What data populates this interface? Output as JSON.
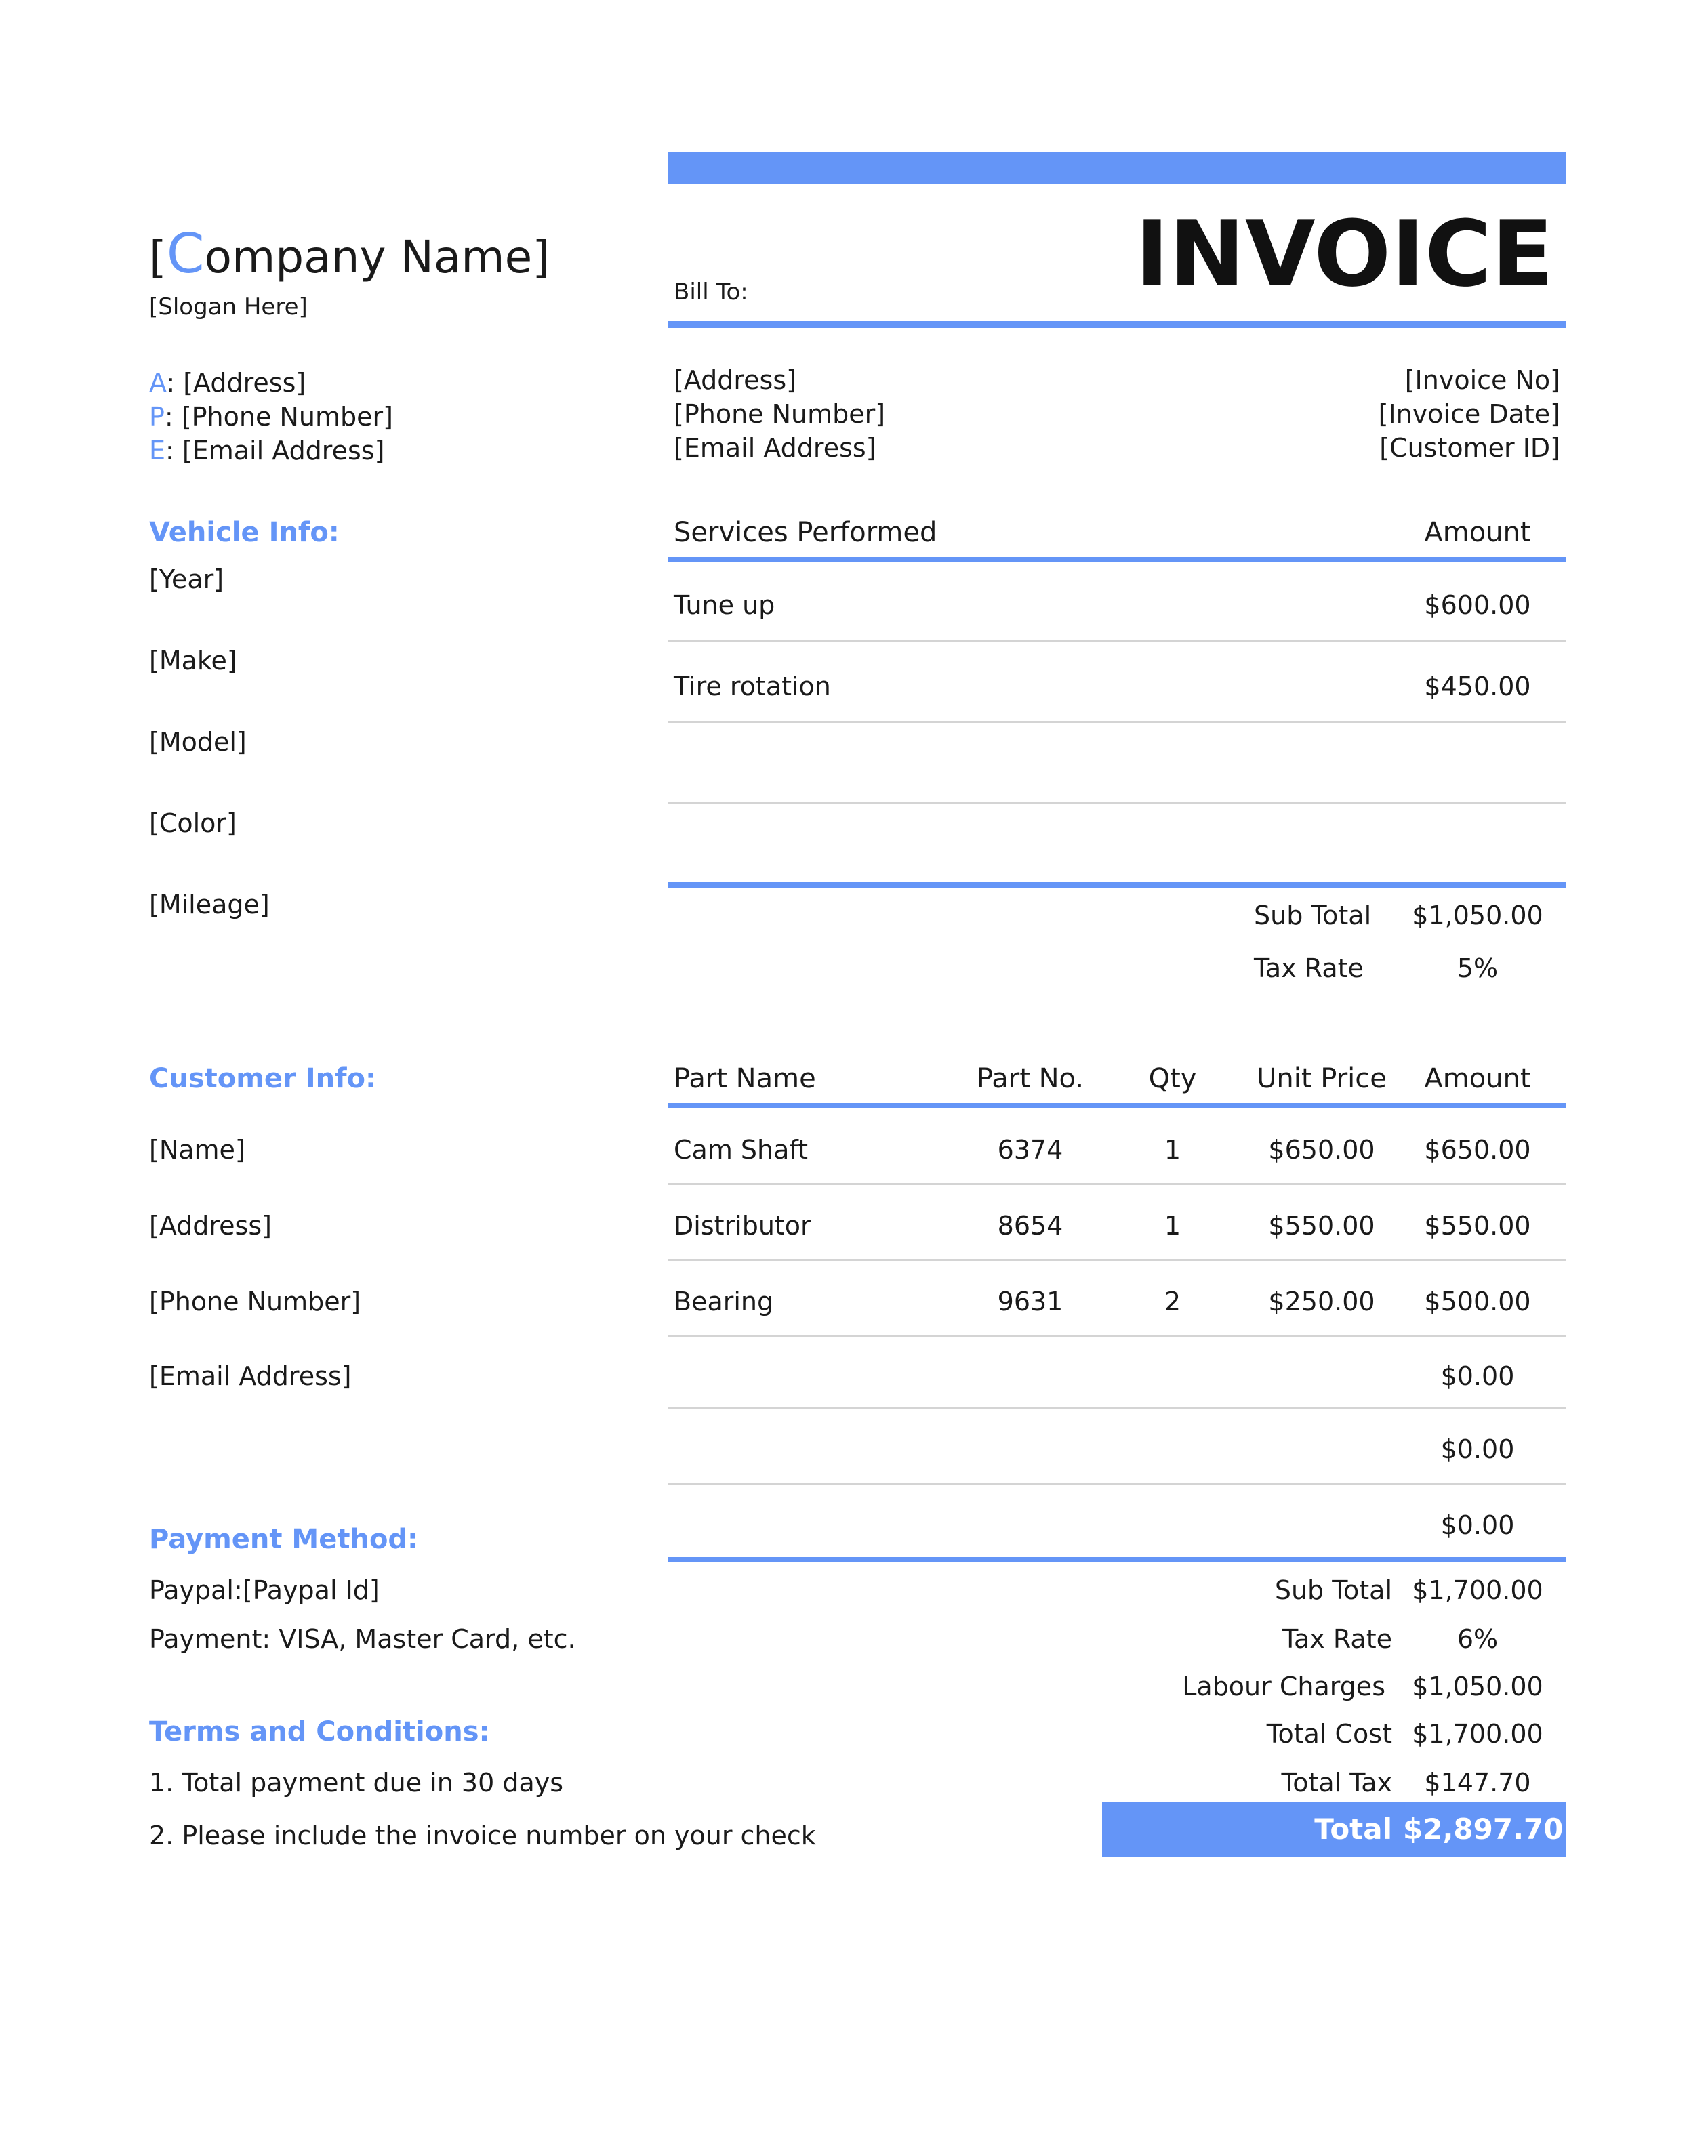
{
  "company": {
    "bracket_open": "[",
    "initial": "C",
    "rest": "ompany Name",
    "bracket_close": "]",
    "slogan": "[Slogan Here]"
  },
  "contact": [
    {
      "key": "A",
      "sep": ": ",
      "value": "[Address]"
    },
    {
      "key": "P",
      "sep": ": ",
      "value": "[Phone Number]"
    },
    {
      "key": "E",
      "sep": ": ",
      "value": "[Email Address]"
    }
  ],
  "invoice_title": "INVOICE",
  "bill_to": {
    "label": "Bill To:",
    "address": "[Address]",
    "phone": "[Phone Number]",
    "email": "[Email Address]"
  },
  "invoice_meta": {
    "number": "[Invoice No]",
    "date": "[Invoice Date]",
    "customer_id": "[Customer ID]"
  },
  "vehicle": {
    "heading": "Vehicle Info:",
    "fields": [
      "[Year]",
      "[Make]",
      "[Model]",
      "[Color]",
      "[Mileage]"
    ]
  },
  "services": {
    "header_service": "Services Performed",
    "header_amount": "Amount",
    "rows": [
      {
        "service": "Tune up",
        "amount": "$600.00"
      },
      {
        "service": "Tire rotation",
        "amount": "$450.00"
      },
      {
        "service": "",
        "amount": ""
      },
      {
        "service": "",
        "amount": ""
      }
    ],
    "subtotal_label": "Sub Total",
    "subtotal": "$1,050.00",
    "tax_label": "Tax Rate",
    "tax": "5%"
  },
  "customer": {
    "heading": "Customer Info:",
    "fields": [
      "[Name]",
      "[Address]",
      "[Phone Number]",
      "[Email Address]"
    ]
  },
  "parts": {
    "headers": {
      "name": "Part Name",
      "no": "Part No.",
      "qty": "Qty",
      "unit": "Unit Price",
      "amount": "Amount"
    },
    "rows": [
      {
        "name": "Cam Shaft",
        "no": "6374",
        "qty": "1",
        "unit": "$650.00",
        "amount": "$650.00"
      },
      {
        "name": "Distributor",
        "no": "8654",
        "qty": "1",
        "unit": "$550.00",
        "amount": "$550.00"
      },
      {
        "name": "Bearing",
        "no": "9631",
        "qty": "2",
        "unit": "$250.00",
        "amount": "$500.00"
      },
      {
        "name": "",
        "no": "",
        "qty": "",
        "unit": "",
        "amount": "$0.00"
      },
      {
        "name": "",
        "no": "",
        "qty": "",
        "unit": "",
        "amount": "$0.00"
      },
      {
        "name": "",
        "no": "",
        "qty": "",
        "unit": "",
        "amount": "$0.00"
      }
    ]
  },
  "totals": {
    "subtotal_label": "Sub Total",
    "subtotal": "$1,700.00",
    "tax_label": "Tax Rate",
    "tax": "6%",
    "labour_label": "Labour Charges",
    "labour": "$1,050.00",
    "cost_label": "Total Cost",
    "cost": "$1,700.00",
    "totaltax_label": "Total Tax",
    "totaltax": "$147.70",
    "total_label": "Total",
    "total": "$2,897.70"
  },
  "payment": {
    "heading": "Payment Method:",
    "paypal": "Paypal:[Paypal Id]",
    "methods": "Payment: VISA, Master Card, etc."
  },
  "terms": {
    "heading": "Terms and Conditions:",
    "items": [
      "1. Total payment due in 30 days",
      "2. Please include the invoice number on your check"
    ]
  },
  "colors": {
    "accent": "#6495f7",
    "divider": "#d4d4d4"
  }
}
